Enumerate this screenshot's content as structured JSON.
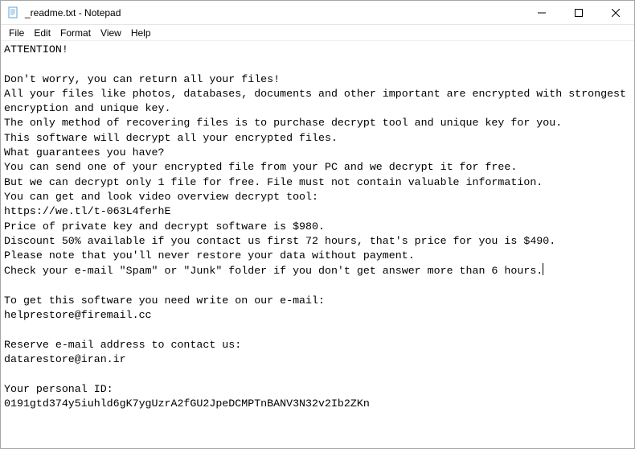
{
  "titlebar": {
    "title": "_readme.txt - Notepad"
  },
  "menubar": {
    "items": [
      "File",
      "Edit",
      "Format",
      "View",
      "Help"
    ]
  },
  "document": {
    "lines": [
      "ATTENTION!",
      "",
      "Don't worry, you can return all your files!",
      "All your files like photos, databases, documents and other important are encrypted with strongest encryption and unique key.",
      "The only method of recovering files is to purchase decrypt tool and unique key for you.",
      "This software will decrypt all your encrypted files.",
      "What guarantees you have?",
      "You can send one of your encrypted file from your PC and we decrypt it for free.",
      "But we can decrypt only 1 file for free. File must not contain valuable information.",
      "You can get and look video overview decrypt tool:",
      "https://we.tl/t-063L4ferhE",
      "Price of private key and decrypt software is $980.",
      "Discount 50% available if you contact us first 72 hours, that's price for you is $490.",
      "Please note that you'll never restore your data without payment.",
      "Check your e-mail \"Spam\" or \"Junk\" folder if you don't get answer more than 6 hours.",
      "",
      "To get this software you need write on our e-mail:",
      "helprestore@firemail.cc",
      "",
      "Reserve e-mail address to contact us:",
      "datarestore@iran.ir",
      "",
      "Your personal ID:",
      "0191gtd374y5iuhld6gK7ygUzrA2fGU2JpeDCMPTnBANV3N32v2Ib2ZKn"
    ]
  }
}
